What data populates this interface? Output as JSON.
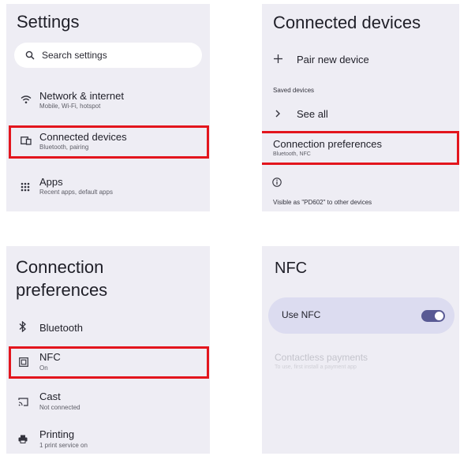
{
  "settings": {
    "title": "Settings",
    "search_placeholder": "Search settings",
    "items": [
      {
        "title": "Network & internet",
        "subtitle": "Mobile, Wi-Fi, hotspot",
        "icon": "wifi-icon"
      },
      {
        "title": "Connected devices",
        "subtitle": "Bluetooth, pairing",
        "icon": "connected-devices-icon"
      },
      {
        "title": "Apps",
        "subtitle": "Recent apps, default apps",
        "icon": "apps-grid-icon"
      }
    ]
  },
  "connected_devices": {
    "title": "Connected devices",
    "pair_new": "Pair new device",
    "saved_devices_header": "Saved devices",
    "see_all": "See all",
    "connection_prefs": {
      "title": "Connection preferences",
      "subtitle": "Bluetooth, NFC"
    },
    "visible_text": "Visible as \"PD602\" to other devices"
  },
  "connection_preferences": {
    "title_line1": "Connection",
    "title_line2": "preferences",
    "items": [
      {
        "title": "Bluetooth",
        "subtitle": "",
        "icon": "bluetooth-icon"
      },
      {
        "title": "NFC",
        "subtitle": "On",
        "icon": "nfc-icon"
      },
      {
        "title": "Cast",
        "subtitle": "Not connected",
        "icon": "cast-icon"
      },
      {
        "title": "Printing",
        "subtitle": "1 print service on",
        "icon": "printer-icon"
      }
    ]
  },
  "nfc": {
    "title": "NFC",
    "use_nfc_label": "Use NFC",
    "use_nfc_on": true,
    "contactless_title": "Contactless payments",
    "contactless_sub": "To use, first install a payment app"
  },
  "colors": {
    "highlight": "#e3151d",
    "panel_bg": "#eeedf4",
    "toggle_on": "#595a94"
  }
}
